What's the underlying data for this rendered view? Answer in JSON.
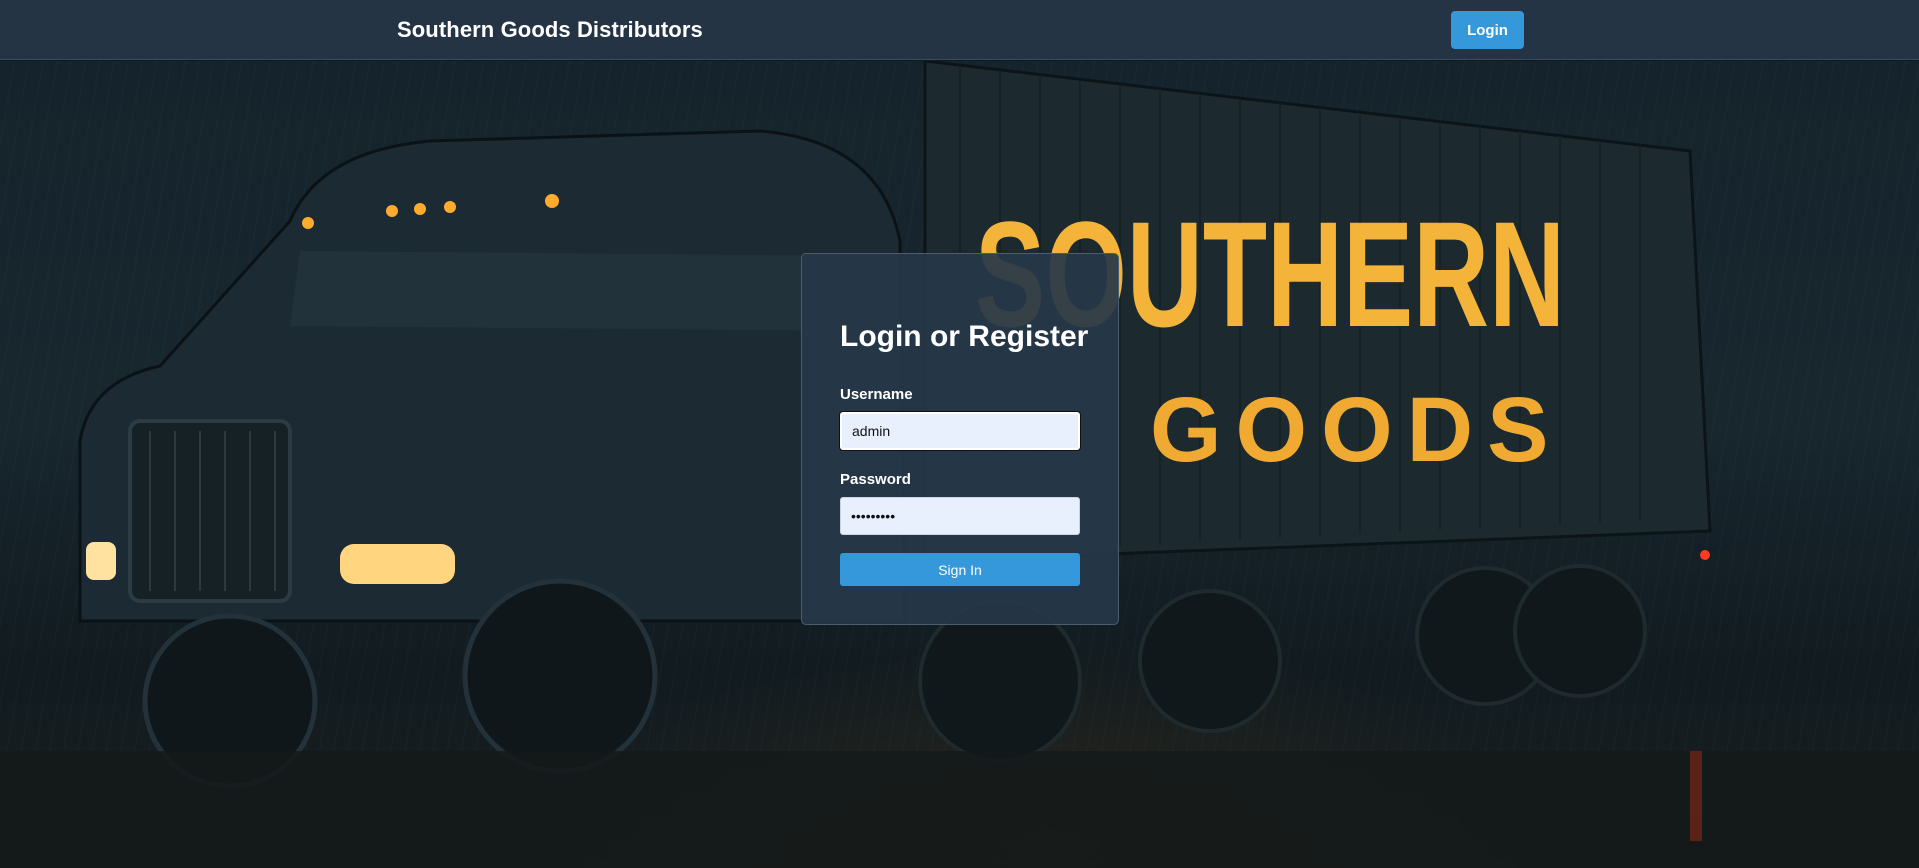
{
  "navbar": {
    "brand": "Southern Goods Distributors",
    "login_label": "Login"
  },
  "hero": {
    "trailer_word_1": "SOUTHERN",
    "trailer_word_2": "GOODS"
  },
  "login_form": {
    "title": "Login or Register",
    "username_label": "Username",
    "username_value": "admin",
    "password_label": "Password",
    "password_value": "•••••••••",
    "sign_in_label": "Sign In"
  },
  "colors": {
    "navbar_bg": "#243444",
    "accent": "#3498db",
    "card_bg": "#263748",
    "input_bg": "#e8f0fe"
  }
}
